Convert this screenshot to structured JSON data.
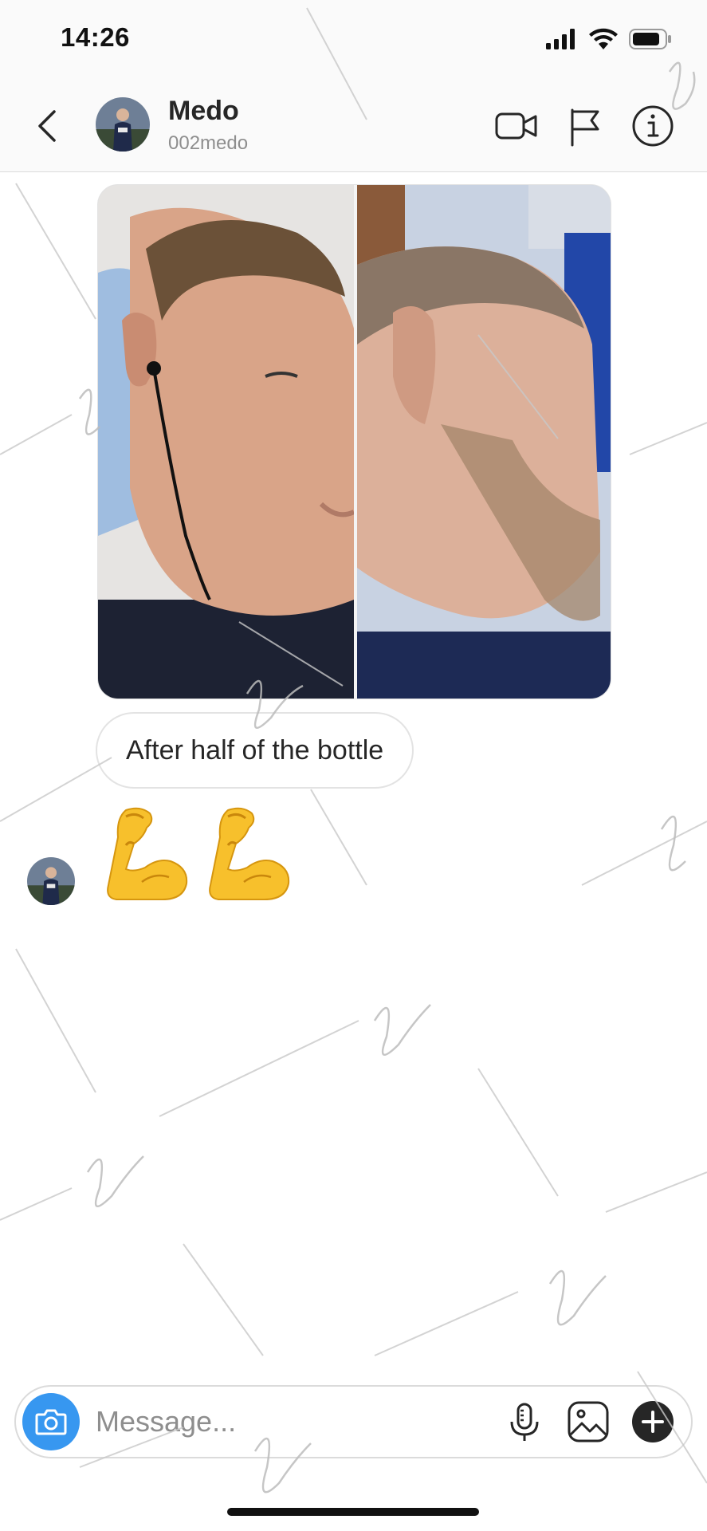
{
  "status_bar": {
    "time": "14:26",
    "icons": [
      "cellular-signal-icon",
      "wifi-icon",
      "battery-icon"
    ]
  },
  "header": {
    "name": "Medo",
    "username": "002medo",
    "icons": [
      "back-chevron-icon",
      "video-call-icon",
      "flag-icon",
      "info-icon"
    ]
  },
  "thread": {
    "messages": [
      {
        "kind": "photo",
        "description_icon": "before-after-photo"
      },
      {
        "kind": "text",
        "text": "After half of the bottle"
      },
      {
        "kind": "emoji",
        "emoji": [
          "💪",
          "💪"
        ],
        "emoji_icon": "flexed-biceps-icon"
      }
    ]
  },
  "composer": {
    "placeholder": "Message...",
    "value": "",
    "icons": [
      "camera-icon",
      "microphone-icon",
      "gallery-icon",
      "plus-icon"
    ]
  },
  "colors": {
    "accent": "#3797f0",
    "text": "#262626",
    "secondary_text": "#8e8e8e",
    "border": "#dbdbdb",
    "emoji_yellow": "#f7c02c"
  }
}
